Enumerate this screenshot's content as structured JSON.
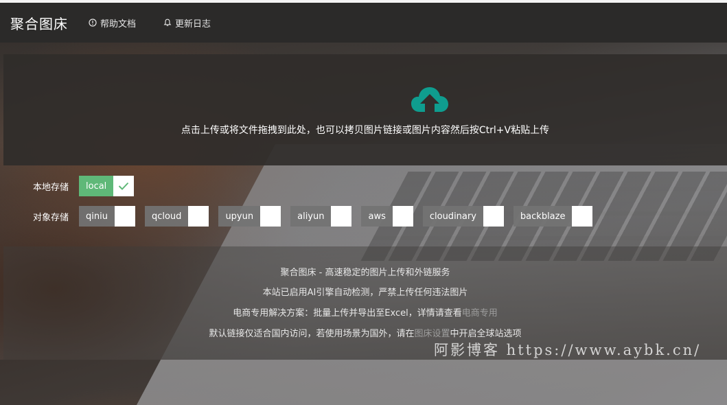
{
  "header": {
    "title": "聚合图床",
    "nav": [
      {
        "label": "帮助文档",
        "icon": "info-circle-icon"
      },
      {
        "label": "更新日志",
        "icon": "bell-icon"
      }
    ]
  },
  "upload": {
    "icon": "cloud-upload-icon",
    "text": "点击上传或将文件拖拽到此处，也可以拷贝图片链接或图片内容然后按Ctrl+V粘贴上传"
  },
  "storage": {
    "local_label": "本地存储",
    "local_options": [
      {
        "name": "local",
        "checked": true
      }
    ],
    "object_label": "对象存储",
    "object_options": [
      {
        "name": "qiniu",
        "checked": false
      },
      {
        "name": "qcloud",
        "checked": false
      },
      {
        "name": "upyun",
        "checked": false
      },
      {
        "name": "aliyun",
        "checked": false
      },
      {
        "name": "aws",
        "checked": false
      },
      {
        "name": "cloudinary",
        "checked": false
      },
      {
        "name": "backblaze",
        "checked": false
      }
    ]
  },
  "footer": {
    "line1": "聚合图床 - 高速稳定的图片上传和外链服务",
    "line2": "本站已启用AI引擎自动检测，严禁上传任何违法图片",
    "line3_prefix": "电商专用解决方案：批量上传并导出至Excel，详情请查看",
    "line3_link": "电商专用",
    "line4_prefix": "默认链接仅适合国内访问，若使用场景为国外，请在",
    "line4_link": "图床设置",
    "line4_suffix": "中开启全球站选项"
  },
  "watermark": "阿影博客 https://www.aybk.cn/",
  "colors": {
    "accent_green": "#5fb878",
    "cloud_teal": "#0f9d8f",
    "header_bg": "#2b2a29"
  }
}
